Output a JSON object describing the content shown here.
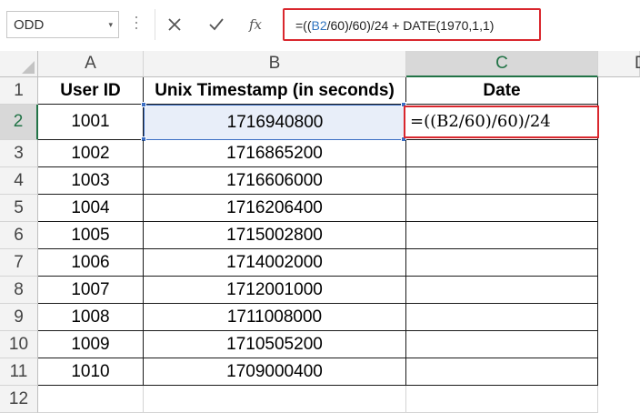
{
  "name_box": {
    "value": "ODD"
  },
  "formula_bar": {
    "prefix": "=((",
    "ref": "B2",
    "middle": "/60)/60)/24 + DATE(1970,1,1)"
  },
  "columns": [
    {
      "id": "A",
      "label": "A"
    },
    {
      "id": "B",
      "label": "B"
    },
    {
      "id": "C",
      "label": "C"
    },
    {
      "id": "D",
      "label": "D"
    }
  ],
  "row_numbers": [
    "1",
    "2",
    "3",
    "4",
    "5",
    "6",
    "7",
    "8",
    "9",
    "10",
    "11",
    "12"
  ],
  "headers": {
    "user_id": "User ID",
    "timestamp": "Unix Timestamp (in seconds)",
    "date": "Date"
  },
  "rows": [
    {
      "user_id": "1001",
      "timestamp": "1716940800"
    },
    {
      "user_id": "1002",
      "timestamp": "1716865200"
    },
    {
      "user_id": "1003",
      "timestamp": "1716606000"
    },
    {
      "user_id": "1004",
      "timestamp": "1716206400"
    },
    {
      "user_id": "1005",
      "timestamp": "1715002800"
    },
    {
      "user_id": "1006",
      "timestamp": "1714002000"
    },
    {
      "user_id": "1007",
      "timestamp": "1712001000"
    },
    {
      "user_id": "1008",
      "timestamp": "1711008000"
    },
    {
      "user_id": "1009",
      "timestamp": "1710505200"
    },
    {
      "user_id": "1010",
      "timestamp": "1709000400"
    }
  ],
  "editing_cell": {
    "ref": "C2",
    "text": "=((B2/60)/60)/24"
  },
  "icons": {
    "cancel": "close-icon",
    "enter": "checkmark-icon",
    "function": "fx-icon"
  },
  "colors": {
    "highlight": "#d9272e",
    "reference": "#2f74c0",
    "selected_header": "#217346"
  }
}
